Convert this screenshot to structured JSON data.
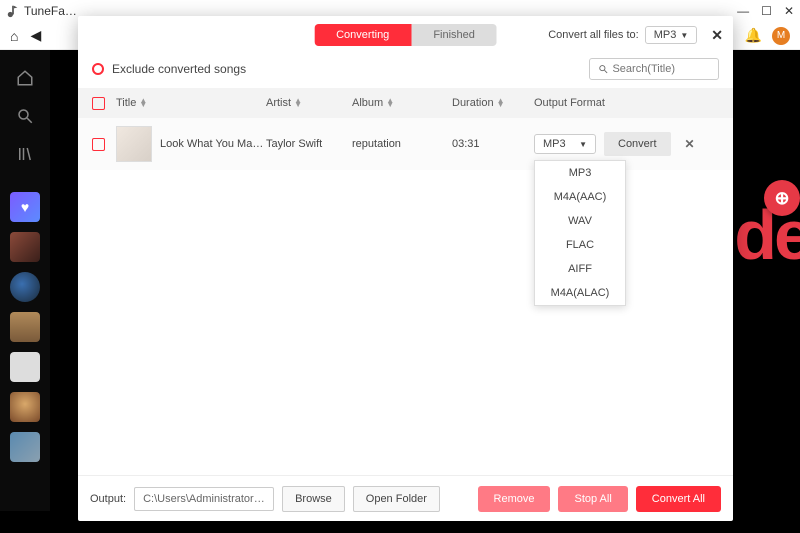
{
  "app": {
    "title": "TuneFa…",
    "avatar_letter": "M"
  },
  "background_text": "de",
  "modal": {
    "tabs": {
      "converting": "Converting",
      "finished": "Finished"
    },
    "convert_all_label": "Convert all files to:",
    "convert_all_format": "MP3",
    "exclude_label": "Exclude converted songs",
    "search_placeholder": "Search(Title)",
    "columns": {
      "title": "Title",
      "artist": "Artist",
      "album": "Album",
      "duration": "Duration",
      "format": "Output Format"
    },
    "row": {
      "title": "Look What You Ma…",
      "artist": "Taylor Swift",
      "album": "reputation",
      "duration": "03:31",
      "format": "MP3",
      "convert_btn": "Convert"
    },
    "format_options": [
      "MP3",
      "M4A(AAC)",
      "WAV",
      "FLAC",
      "AIFF",
      "M4A(ALAC)"
    ],
    "footer": {
      "output_label": "Output:",
      "output_path": "C:\\Users\\Administrator\\Des…",
      "browse": "Browse",
      "open_folder": "Open Folder",
      "remove": "Remove",
      "stop_all": "Stop All",
      "convert_all": "Convert All"
    }
  }
}
